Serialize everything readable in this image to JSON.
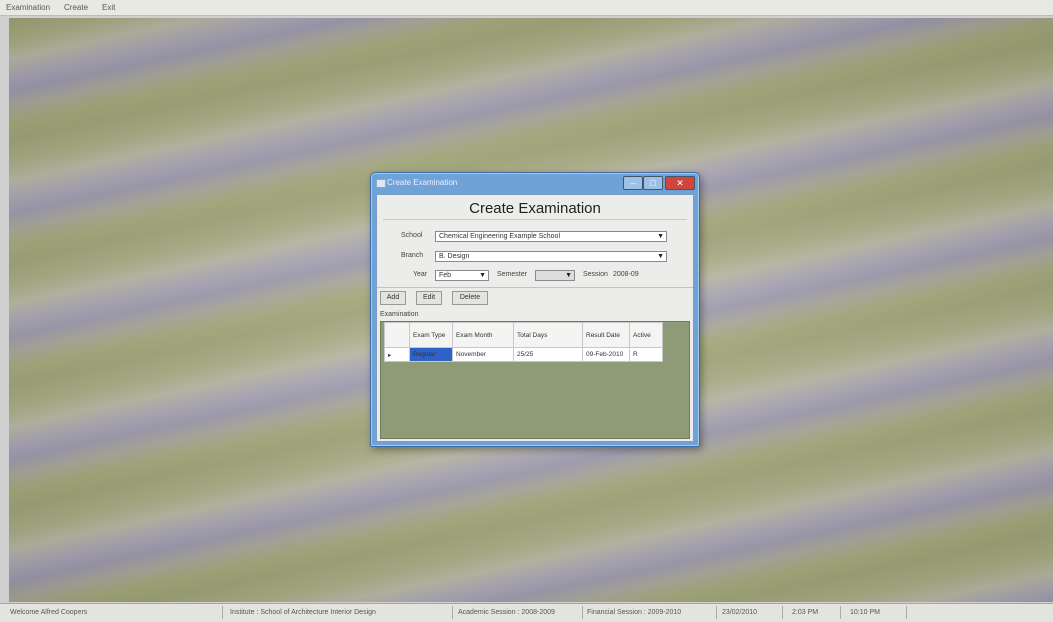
{
  "menubar": {
    "items": [
      "Examination",
      "Create",
      "Exit"
    ]
  },
  "dialog": {
    "window_title": "Create Examination",
    "heading": "Create Examination",
    "school": {
      "label": "School",
      "value": "Chemical Engineering Example School"
    },
    "branch": {
      "label": "Branch",
      "value": "B. Design"
    },
    "year": {
      "label": "Year",
      "value": "Feb"
    },
    "semester": {
      "label": "Semester",
      "value": ""
    },
    "session": {
      "label": "Session",
      "value": "2008-09"
    },
    "buttons": {
      "add": "Add",
      "edit": "Edit",
      "delete": "Delete"
    },
    "grid_caption": "Examination",
    "grid": {
      "headers": [
        "Exam Type",
        "Exam Month",
        "Total Days",
        "Result Date",
        "Active"
      ],
      "rows": [
        {
          "marker": "▸",
          "cells": [
            "Regular",
            "November",
            "25/25",
            "09-Feb-2010",
            "R"
          ]
        }
      ]
    }
  },
  "statusbar": {
    "user": "Welcome Alfred Coopers",
    "institute": "Institute : School of Architecture Interior Design",
    "session": "Academic Session : 2008-2009",
    "financial": "Financial Session : 2009-2010",
    "date": "23/02/2010",
    "time1": "2:03 PM",
    "time2": "10:10 PM"
  },
  "colors": {
    "title_bar": "#6fa3d8",
    "close_button": "#d0463c",
    "selection": "#2f62c6"
  }
}
